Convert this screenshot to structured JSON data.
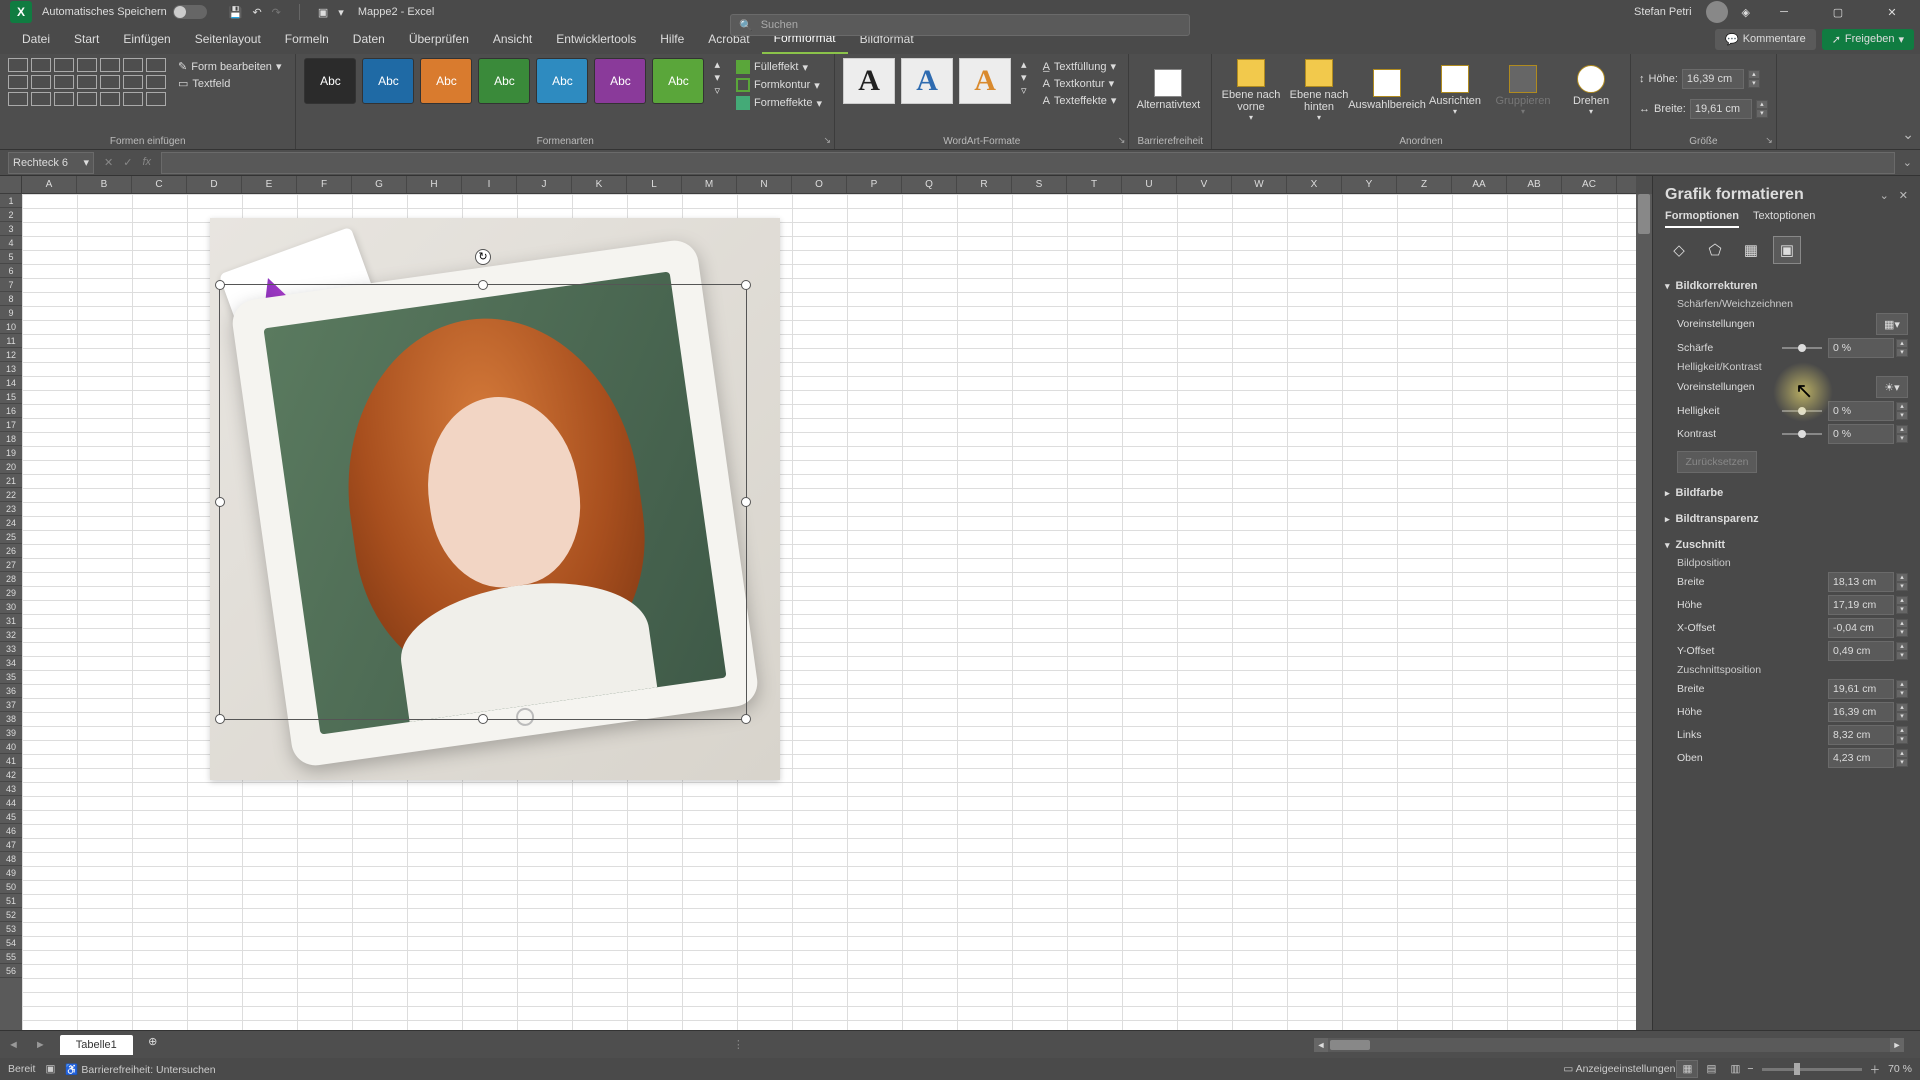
{
  "titlebar": {
    "autosave_label": "Automatisches Speichern",
    "doc_name": "Mappe2",
    "app_name": "Excel",
    "search_placeholder": "Suchen",
    "user_name": "Stefan Petri"
  },
  "tabs": {
    "items": [
      "Datei",
      "Start",
      "Einfügen",
      "Seitenlayout",
      "Formeln",
      "Daten",
      "Überprüfen",
      "Ansicht",
      "Entwicklertools",
      "Hilfe",
      "Acrobat",
      "Formformat",
      "Bildformat"
    ],
    "active_index": 11,
    "comments": "Kommentare",
    "share": "Freigeben"
  },
  "ribbon": {
    "insert_shapes": {
      "label": "Formen einfügen",
      "edit_shape": "Form bearbeiten",
      "textfield": "Textfeld"
    },
    "shape_styles": {
      "label": "Formenarten",
      "swatches": [
        {
          "bg": "#2b2b2b",
          "txt": "Abc"
        },
        {
          "bg": "#1f6aa5",
          "txt": "Abc"
        },
        {
          "bg": "#d97b2e",
          "txt": "Abc"
        },
        {
          "bg": "#3a8a3a",
          "txt": "Abc"
        },
        {
          "bg": "#2e8bc0",
          "txt": "Abc"
        },
        {
          "bg": "#8a3a9a",
          "txt": "Abc"
        },
        {
          "bg": "#5aa63a",
          "txt": "Abc"
        }
      ],
      "fill": "Fülleffekt",
      "outline": "Formkontur",
      "effects": "Formeffekte"
    },
    "wordart": {
      "label": "WordArt-Formate",
      "textfill": "Textfüllung",
      "textoutline": "Textkontur",
      "texteffects": "Texteffekte"
    },
    "accessibility": {
      "label": "Barrierefreiheit",
      "alt_text": "Alternativtext"
    },
    "arrange": {
      "label": "Anordnen",
      "forward": "Ebene nach vorne",
      "backward": "Ebene nach hinten",
      "selpane": "Auswahlbereich",
      "align": "Ausrichten",
      "group": "Gruppieren",
      "rotate": "Drehen"
    },
    "size": {
      "label": "Größe",
      "height_label": "Höhe:",
      "height_val": "16,39 cm",
      "width_label": "Breite:",
      "width_val": "19,61 cm"
    }
  },
  "namebox": {
    "value": "Rechteck 6"
  },
  "columns": [
    "A",
    "B",
    "C",
    "D",
    "E",
    "F",
    "G",
    "H",
    "I",
    "J",
    "K",
    "L",
    "M",
    "N",
    "O",
    "P",
    "Q",
    "R",
    "S",
    "T",
    "U",
    "V",
    "W",
    "X",
    "Y",
    "Z",
    "AA",
    "AB",
    "AC"
  ],
  "pane": {
    "title": "Grafik formatieren",
    "tab_form": "Formoptionen",
    "tab_text": "Textoptionen",
    "corrections": "Bildkorrekturen",
    "sharpen_soften": "Schärfen/Weichzeichnen",
    "presets": "Voreinstellungen",
    "sharpness": "Schärfe",
    "sharpness_val": "0 %",
    "bright_contrast": "Helligkeit/Kontrast",
    "brightness": "Helligkeit",
    "brightness_val": "0 %",
    "contrast": "Kontrast",
    "contrast_val": "0 %",
    "reset": "Zurücksetzen",
    "color": "Bildfarbe",
    "transparency": "Bildtransparenz",
    "crop": "Zuschnitt",
    "pic_position": "Bildposition",
    "width": "Breite",
    "width_val": "18,13 cm",
    "height": "Höhe",
    "height_val": "17,19 cm",
    "xoff": "X-Offset",
    "xoff_val": "-0,04 cm",
    "yoff": "Y-Offset",
    "yoff_val": "0,49 cm",
    "crop_position": "Zuschnittsposition",
    "cwidth_val": "19,61 cm",
    "cheight_val": "16,39 cm",
    "left": "Links",
    "left_val": "8,32 cm",
    "top": "Oben",
    "top_val": "4,23 cm"
  },
  "sheets": {
    "tab1": "Tabelle1"
  },
  "status": {
    "ready": "Bereit",
    "accessibility": "Barrierefreiheit: Untersuchen",
    "display_settings": "Anzeigeeinstellungen",
    "zoom": "70 %"
  }
}
